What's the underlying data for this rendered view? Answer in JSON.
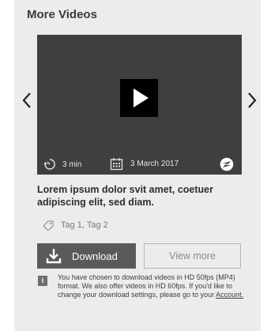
{
  "section": {
    "title": "More Videos"
  },
  "video": {
    "duration": "3 min",
    "date": "3 March 2017"
  },
  "item": {
    "description": "Lorem ipsum dolor svit amet, coetuer adipiscing elit, sed diam.",
    "tags": "Tag 1, Tag 2"
  },
  "actions": {
    "download_label": "Download",
    "view_more_label": "View more"
  },
  "notice": {
    "text": "You have chosen to download videos in HD 50fps (MP4) format. We also offer videos in HD 60fps. If you'd like to change your download settings, please go to your",
    "link_label": "Account."
  },
  "icons": {
    "prev": "chevron-left-icon",
    "next": "chevron-right-icon",
    "play": "play-icon",
    "duration": "timer-icon",
    "date": "calendar-icon",
    "share": "share-icon",
    "tag": "tag-icon",
    "download": "download-icon",
    "info": "info-icon"
  },
  "colors": {
    "panel": "#ececec",
    "video": "#3f3f3f",
    "primary_button": "#5a5a5a"
  }
}
